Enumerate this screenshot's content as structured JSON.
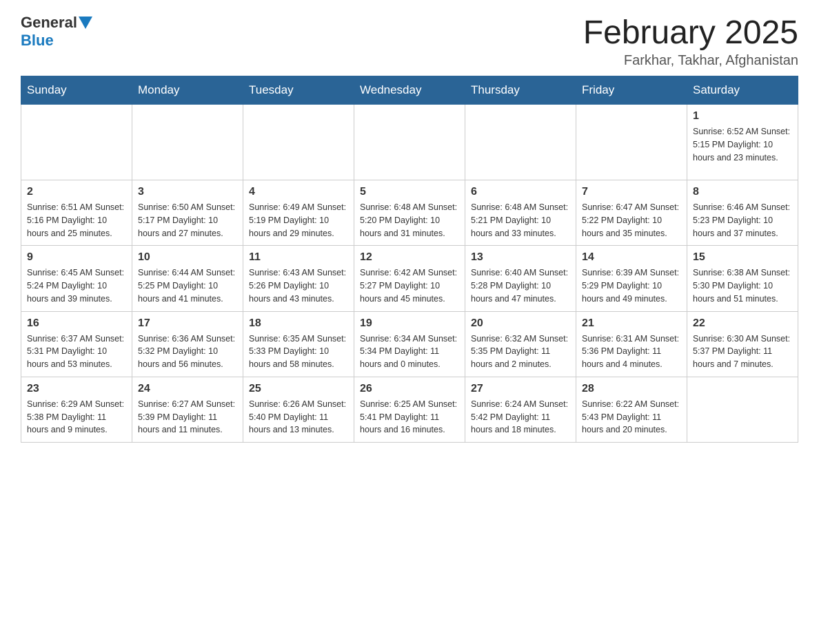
{
  "header": {
    "logo_general": "General",
    "logo_blue": "Blue",
    "month_title": "February 2025",
    "location": "Farkhar, Takhar, Afghanistan"
  },
  "days_of_week": [
    "Sunday",
    "Monday",
    "Tuesday",
    "Wednesday",
    "Thursday",
    "Friday",
    "Saturday"
  ],
  "weeks": [
    [
      {
        "day": "",
        "info": ""
      },
      {
        "day": "",
        "info": ""
      },
      {
        "day": "",
        "info": ""
      },
      {
        "day": "",
        "info": ""
      },
      {
        "day": "",
        "info": ""
      },
      {
        "day": "",
        "info": ""
      },
      {
        "day": "1",
        "info": "Sunrise: 6:52 AM\nSunset: 5:15 PM\nDaylight: 10 hours\nand 23 minutes."
      }
    ],
    [
      {
        "day": "2",
        "info": "Sunrise: 6:51 AM\nSunset: 5:16 PM\nDaylight: 10 hours\nand 25 minutes."
      },
      {
        "day": "3",
        "info": "Sunrise: 6:50 AM\nSunset: 5:17 PM\nDaylight: 10 hours\nand 27 minutes."
      },
      {
        "day": "4",
        "info": "Sunrise: 6:49 AM\nSunset: 5:19 PM\nDaylight: 10 hours\nand 29 minutes."
      },
      {
        "day": "5",
        "info": "Sunrise: 6:48 AM\nSunset: 5:20 PM\nDaylight: 10 hours\nand 31 minutes."
      },
      {
        "day": "6",
        "info": "Sunrise: 6:48 AM\nSunset: 5:21 PM\nDaylight: 10 hours\nand 33 minutes."
      },
      {
        "day": "7",
        "info": "Sunrise: 6:47 AM\nSunset: 5:22 PM\nDaylight: 10 hours\nand 35 minutes."
      },
      {
        "day": "8",
        "info": "Sunrise: 6:46 AM\nSunset: 5:23 PM\nDaylight: 10 hours\nand 37 minutes."
      }
    ],
    [
      {
        "day": "9",
        "info": "Sunrise: 6:45 AM\nSunset: 5:24 PM\nDaylight: 10 hours\nand 39 minutes."
      },
      {
        "day": "10",
        "info": "Sunrise: 6:44 AM\nSunset: 5:25 PM\nDaylight: 10 hours\nand 41 minutes."
      },
      {
        "day": "11",
        "info": "Sunrise: 6:43 AM\nSunset: 5:26 PM\nDaylight: 10 hours\nand 43 minutes."
      },
      {
        "day": "12",
        "info": "Sunrise: 6:42 AM\nSunset: 5:27 PM\nDaylight: 10 hours\nand 45 minutes."
      },
      {
        "day": "13",
        "info": "Sunrise: 6:40 AM\nSunset: 5:28 PM\nDaylight: 10 hours\nand 47 minutes."
      },
      {
        "day": "14",
        "info": "Sunrise: 6:39 AM\nSunset: 5:29 PM\nDaylight: 10 hours\nand 49 minutes."
      },
      {
        "day": "15",
        "info": "Sunrise: 6:38 AM\nSunset: 5:30 PM\nDaylight: 10 hours\nand 51 minutes."
      }
    ],
    [
      {
        "day": "16",
        "info": "Sunrise: 6:37 AM\nSunset: 5:31 PM\nDaylight: 10 hours\nand 53 minutes."
      },
      {
        "day": "17",
        "info": "Sunrise: 6:36 AM\nSunset: 5:32 PM\nDaylight: 10 hours\nand 56 minutes."
      },
      {
        "day": "18",
        "info": "Sunrise: 6:35 AM\nSunset: 5:33 PM\nDaylight: 10 hours\nand 58 minutes."
      },
      {
        "day": "19",
        "info": "Sunrise: 6:34 AM\nSunset: 5:34 PM\nDaylight: 11 hours\nand 0 minutes."
      },
      {
        "day": "20",
        "info": "Sunrise: 6:32 AM\nSunset: 5:35 PM\nDaylight: 11 hours\nand 2 minutes."
      },
      {
        "day": "21",
        "info": "Sunrise: 6:31 AM\nSunset: 5:36 PM\nDaylight: 11 hours\nand 4 minutes."
      },
      {
        "day": "22",
        "info": "Sunrise: 6:30 AM\nSunset: 5:37 PM\nDaylight: 11 hours\nand 7 minutes."
      }
    ],
    [
      {
        "day": "23",
        "info": "Sunrise: 6:29 AM\nSunset: 5:38 PM\nDaylight: 11 hours\nand 9 minutes."
      },
      {
        "day": "24",
        "info": "Sunrise: 6:27 AM\nSunset: 5:39 PM\nDaylight: 11 hours\nand 11 minutes."
      },
      {
        "day": "25",
        "info": "Sunrise: 6:26 AM\nSunset: 5:40 PM\nDaylight: 11 hours\nand 13 minutes."
      },
      {
        "day": "26",
        "info": "Sunrise: 6:25 AM\nSunset: 5:41 PM\nDaylight: 11 hours\nand 16 minutes."
      },
      {
        "day": "27",
        "info": "Sunrise: 6:24 AM\nSunset: 5:42 PM\nDaylight: 11 hours\nand 18 minutes."
      },
      {
        "day": "28",
        "info": "Sunrise: 6:22 AM\nSunset: 5:43 PM\nDaylight: 11 hours\nand 20 minutes."
      },
      {
        "day": "",
        "info": ""
      }
    ]
  ]
}
